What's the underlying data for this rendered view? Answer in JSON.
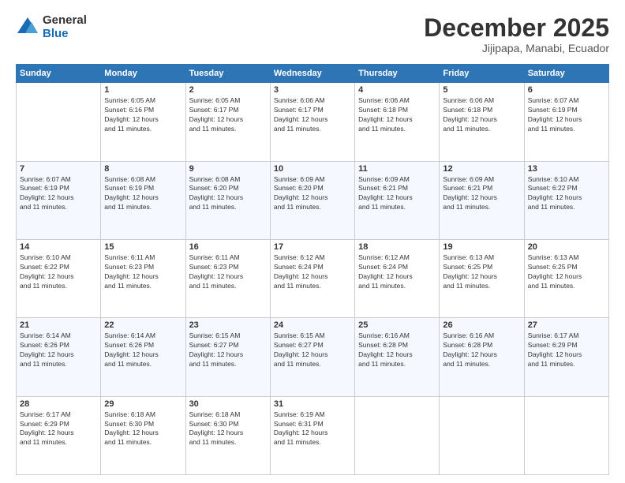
{
  "logo": {
    "general": "General",
    "blue": "Blue"
  },
  "header": {
    "month_year": "December 2025",
    "location": "Jijipapa, Manabi, Ecuador"
  },
  "weekdays": [
    "Sunday",
    "Monday",
    "Tuesday",
    "Wednesday",
    "Thursday",
    "Friday",
    "Saturday"
  ],
  "weeks": [
    [
      {
        "day": "",
        "info": ""
      },
      {
        "day": "1",
        "info": "Sunrise: 6:05 AM\nSunset: 6:16 PM\nDaylight: 12 hours\nand 11 minutes."
      },
      {
        "day": "2",
        "info": "Sunrise: 6:05 AM\nSunset: 6:17 PM\nDaylight: 12 hours\nand 11 minutes."
      },
      {
        "day": "3",
        "info": "Sunrise: 6:06 AM\nSunset: 6:17 PM\nDaylight: 12 hours\nand 11 minutes."
      },
      {
        "day": "4",
        "info": "Sunrise: 6:06 AM\nSunset: 6:18 PM\nDaylight: 12 hours\nand 11 minutes."
      },
      {
        "day": "5",
        "info": "Sunrise: 6:06 AM\nSunset: 6:18 PM\nDaylight: 12 hours\nand 11 minutes."
      },
      {
        "day": "6",
        "info": "Sunrise: 6:07 AM\nSunset: 6:19 PM\nDaylight: 12 hours\nand 11 minutes."
      }
    ],
    [
      {
        "day": "7",
        "info": "Sunrise: 6:07 AM\nSunset: 6:19 PM\nDaylight: 12 hours\nand 11 minutes."
      },
      {
        "day": "8",
        "info": "Sunrise: 6:08 AM\nSunset: 6:19 PM\nDaylight: 12 hours\nand 11 minutes."
      },
      {
        "day": "9",
        "info": "Sunrise: 6:08 AM\nSunset: 6:20 PM\nDaylight: 12 hours\nand 11 minutes."
      },
      {
        "day": "10",
        "info": "Sunrise: 6:09 AM\nSunset: 6:20 PM\nDaylight: 12 hours\nand 11 minutes."
      },
      {
        "day": "11",
        "info": "Sunrise: 6:09 AM\nSunset: 6:21 PM\nDaylight: 12 hours\nand 11 minutes."
      },
      {
        "day": "12",
        "info": "Sunrise: 6:09 AM\nSunset: 6:21 PM\nDaylight: 12 hours\nand 11 minutes."
      },
      {
        "day": "13",
        "info": "Sunrise: 6:10 AM\nSunset: 6:22 PM\nDaylight: 12 hours\nand 11 minutes."
      }
    ],
    [
      {
        "day": "14",
        "info": "Sunrise: 6:10 AM\nSunset: 6:22 PM\nDaylight: 12 hours\nand 11 minutes."
      },
      {
        "day": "15",
        "info": "Sunrise: 6:11 AM\nSunset: 6:23 PM\nDaylight: 12 hours\nand 11 minutes."
      },
      {
        "day": "16",
        "info": "Sunrise: 6:11 AM\nSunset: 6:23 PM\nDaylight: 12 hours\nand 11 minutes."
      },
      {
        "day": "17",
        "info": "Sunrise: 6:12 AM\nSunset: 6:24 PM\nDaylight: 12 hours\nand 11 minutes."
      },
      {
        "day": "18",
        "info": "Sunrise: 6:12 AM\nSunset: 6:24 PM\nDaylight: 12 hours\nand 11 minutes."
      },
      {
        "day": "19",
        "info": "Sunrise: 6:13 AM\nSunset: 6:25 PM\nDaylight: 12 hours\nand 11 minutes."
      },
      {
        "day": "20",
        "info": "Sunrise: 6:13 AM\nSunset: 6:25 PM\nDaylight: 12 hours\nand 11 minutes."
      }
    ],
    [
      {
        "day": "21",
        "info": "Sunrise: 6:14 AM\nSunset: 6:26 PM\nDaylight: 12 hours\nand 11 minutes."
      },
      {
        "day": "22",
        "info": "Sunrise: 6:14 AM\nSunset: 6:26 PM\nDaylight: 12 hours\nand 11 minutes."
      },
      {
        "day": "23",
        "info": "Sunrise: 6:15 AM\nSunset: 6:27 PM\nDaylight: 12 hours\nand 11 minutes."
      },
      {
        "day": "24",
        "info": "Sunrise: 6:15 AM\nSunset: 6:27 PM\nDaylight: 12 hours\nand 11 minutes."
      },
      {
        "day": "25",
        "info": "Sunrise: 6:16 AM\nSunset: 6:28 PM\nDaylight: 12 hours\nand 11 minutes."
      },
      {
        "day": "26",
        "info": "Sunrise: 6:16 AM\nSunset: 6:28 PM\nDaylight: 12 hours\nand 11 minutes."
      },
      {
        "day": "27",
        "info": "Sunrise: 6:17 AM\nSunset: 6:29 PM\nDaylight: 12 hours\nand 11 minutes."
      }
    ],
    [
      {
        "day": "28",
        "info": "Sunrise: 6:17 AM\nSunset: 6:29 PM\nDaylight: 12 hours\nand 11 minutes."
      },
      {
        "day": "29",
        "info": "Sunrise: 6:18 AM\nSunset: 6:30 PM\nDaylight: 12 hours\nand 11 minutes."
      },
      {
        "day": "30",
        "info": "Sunrise: 6:18 AM\nSunset: 6:30 PM\nDaylight: 12 hours\nand 11 minutes."
      },
      {
        "day": "31",
        "info": "Sunrise: 6:19 AM\nSunset: 6:31 PM\nDaylight: 12 hours\nand 11 minutes."
      },
      {
        "day": "",
        "info": ""
      },
      {
        "day": "",
        "info": ""
      },
      {
        "day": "",
        "info": ""
      }
    ]
  ]
}
